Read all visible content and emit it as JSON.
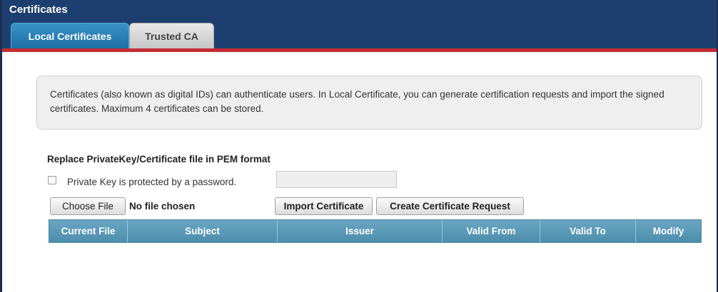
{
  "window": {
    "title": "Certificates"
  },
  "tabs": [
    {
      "label": "Local Certificates",
      "active": true
    },
    {
      "label": "Trusted CA",
      "active": false
    }
  ],
  "notice": {
    "text": "Certificates (also known as digital IDs) can authenticate users. In Local Certificate, you can generate certification requests and import the signed certificates. Maximum 4 certificates can be stored."
  },
  "form": {
    "section_title": "Replace PrivateKey/Certificate file in PEM format",
    "password_checkbox_label": "Private Key is protected by a password.",
    "password_checked": false,
    "password_value": "",
    "choose_file_label": "Choose File",
    "file_status": "No file chosen",
    "import_label": "Import Certificate",
    "create_request_label": "Create Certificate Request"
  },
  "table": {
    "columns": [
      "Current File",
      "Subject",
      "Issuer",
      "Valid From",
      "Valid To",
      "Modify"
    ],
    "rows": []
  },
  "colors": {
    "header_bg": "#1d3f6f",
    "active_tab": "#2a82bb",
    "accent_red": "#c62b33",
    "table_header": "#5b9aba"
  }
}
